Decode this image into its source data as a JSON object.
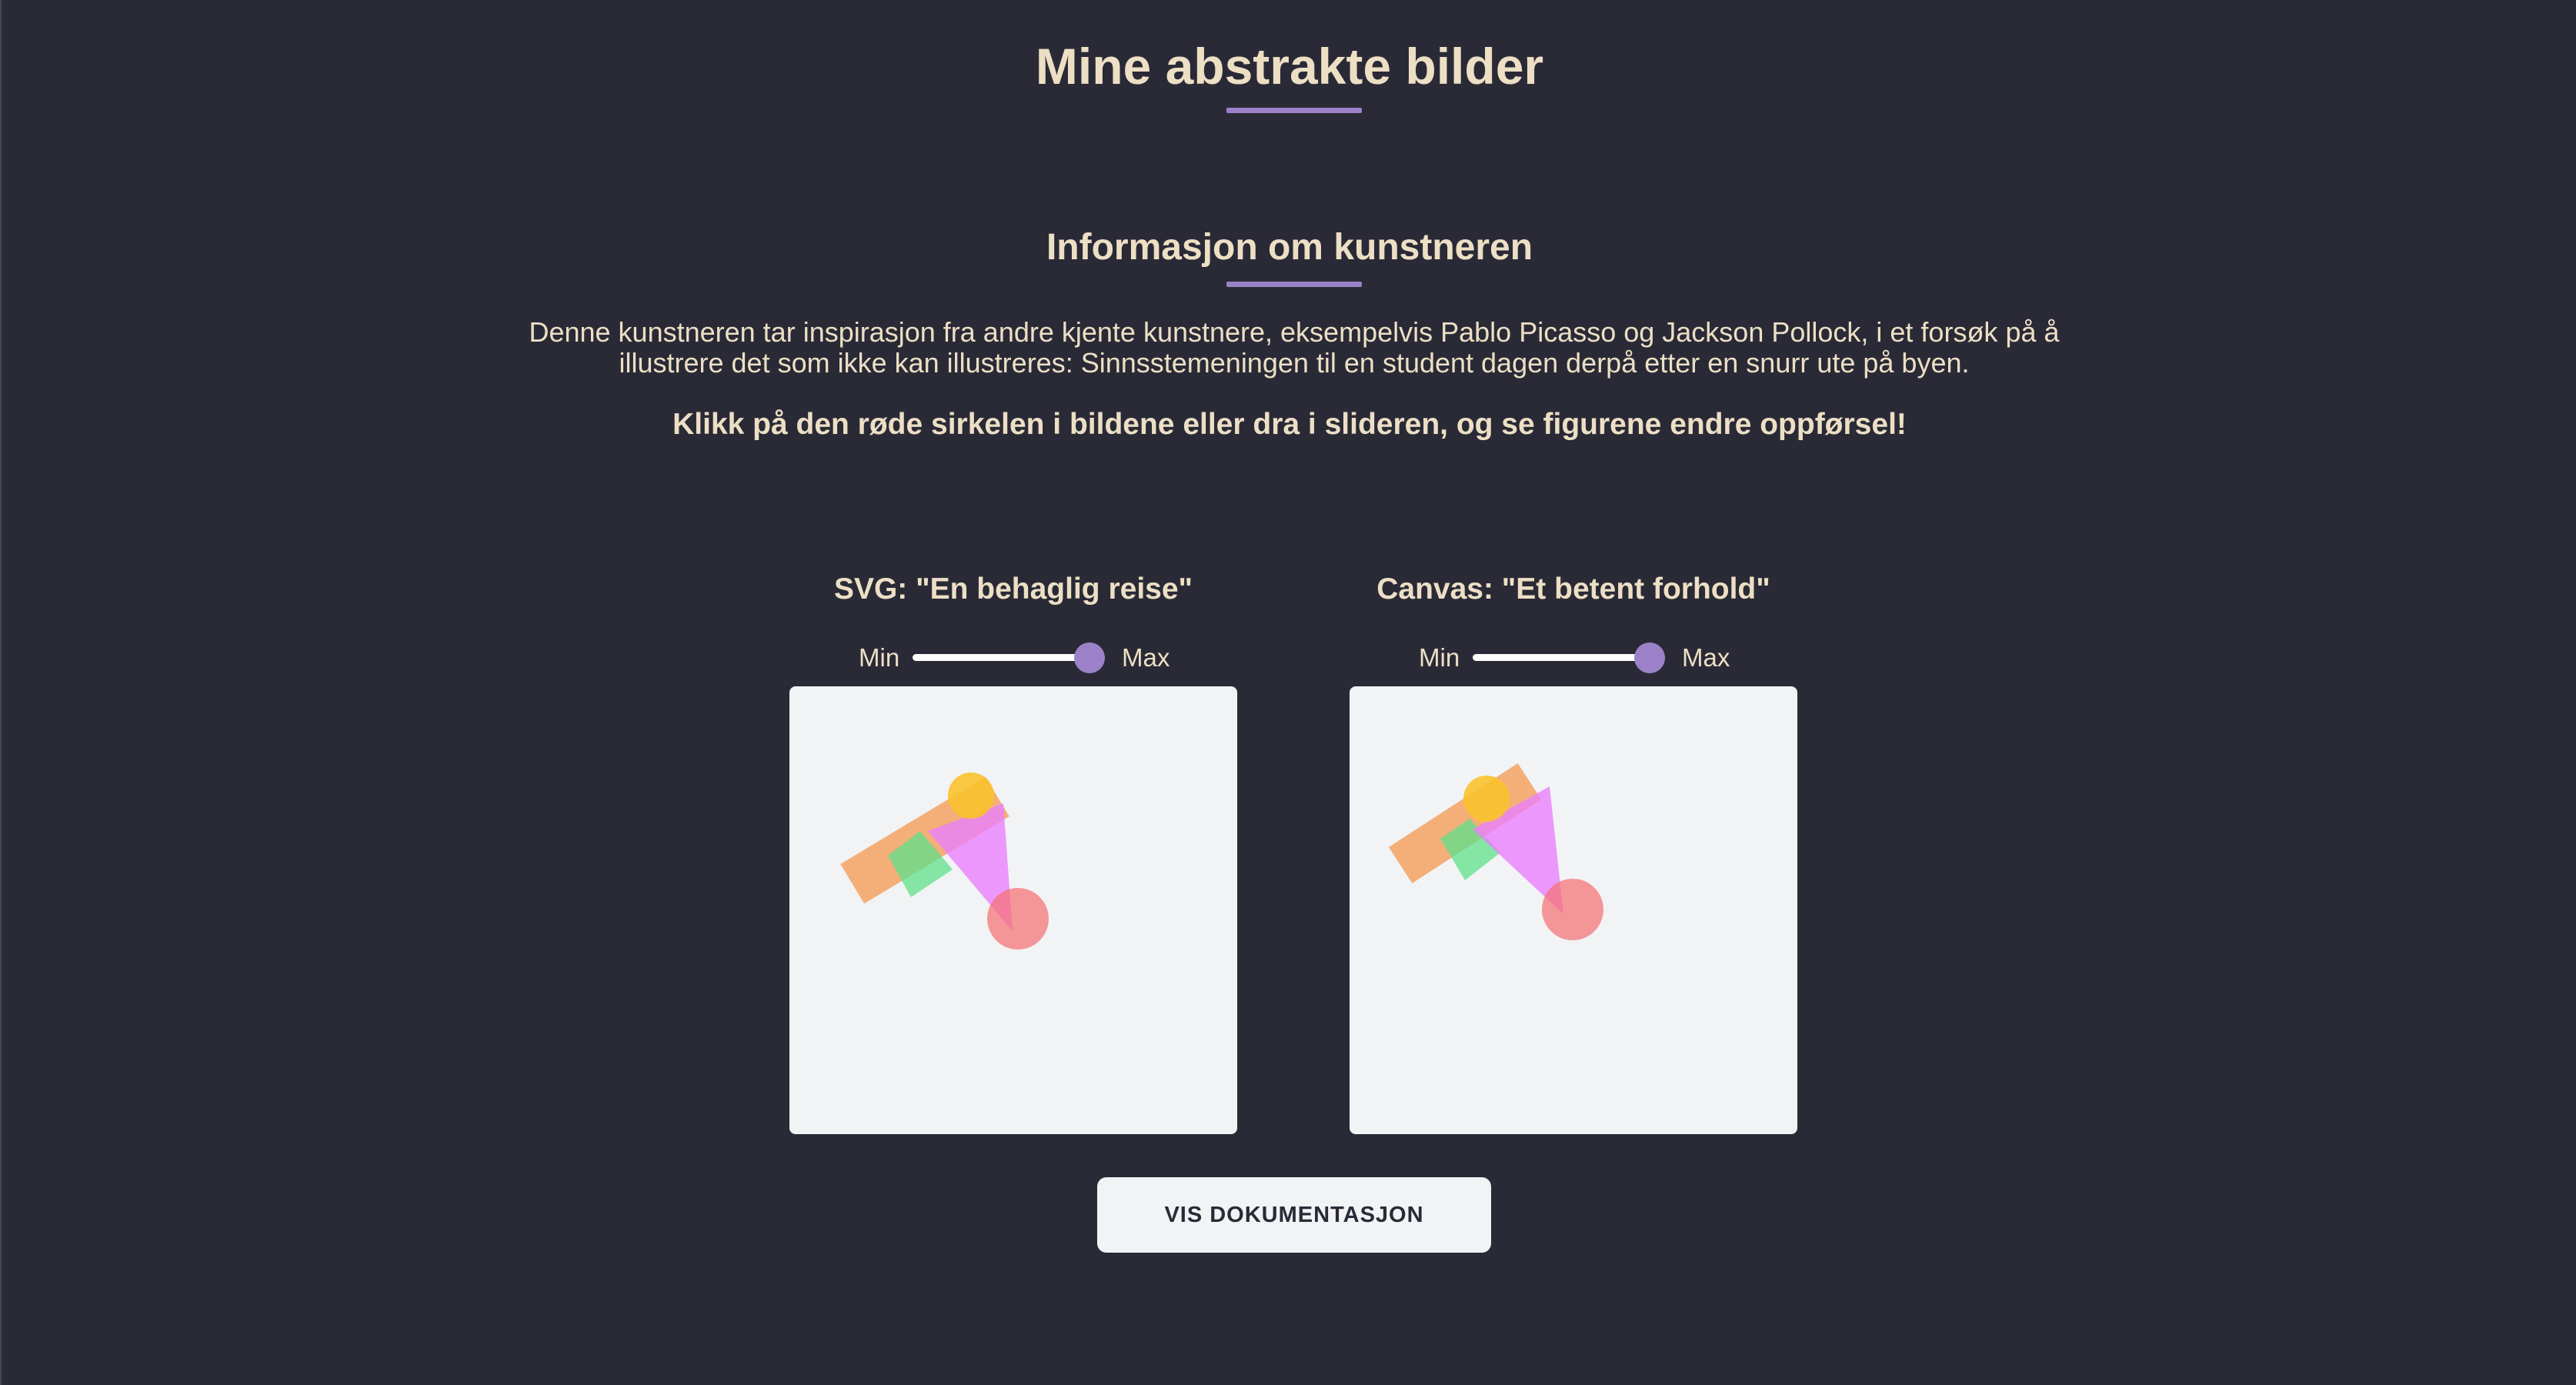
{
  "page": {
    "title": "Mine abstrakte bilder"
  },
  "info": {
    "heading": "Informasjon om kunstneren",
    "text": "Denne kunstneren tar inspirasjon fra andre kjente kunstnere, eksempelvis Pablo Picasso og Jackson Pollock, i et forsøk på å illustrere det som ikke kan illustreres: Sinnsstemeningen til en student dagen derpå etter en snurr ute på byen.",
    "call_to_action": "Klikk på den røde sirkelen i bildene eller dra i slideren, og se figurene endre oppførsel!"
  },
  "artworks": [
    {
      "title": "SVG: \"En behaglig reise\"",
      "slider": {
        "min_label": "Min",
        "max_label": "Max",
        "value": 0.92
      }
    },
    {
      "title": "Canvas: \"Et betent forhold\"",
      "slider": {
        "min_label": "Min",
        "max_label": "Max",
        "value": 0.92
      }
    }
  ],
  "actions": {
    "docs_button": "VIS DOKUMENTASJON"
  },
  "colors": {
    "background": "#2a2a37",
    "text": "#ecdfc4",
    "accent": "#9b82c8",
    "frame": "#f2f3f5",
    "shape_orange": "#f4a261",
    "shape_yellow": "#f9c22e",
    "shape_violet": "#ea80fc",
    "shape_green": "#5fe08a",
    "shape_red": "#f47174"
  }
}
